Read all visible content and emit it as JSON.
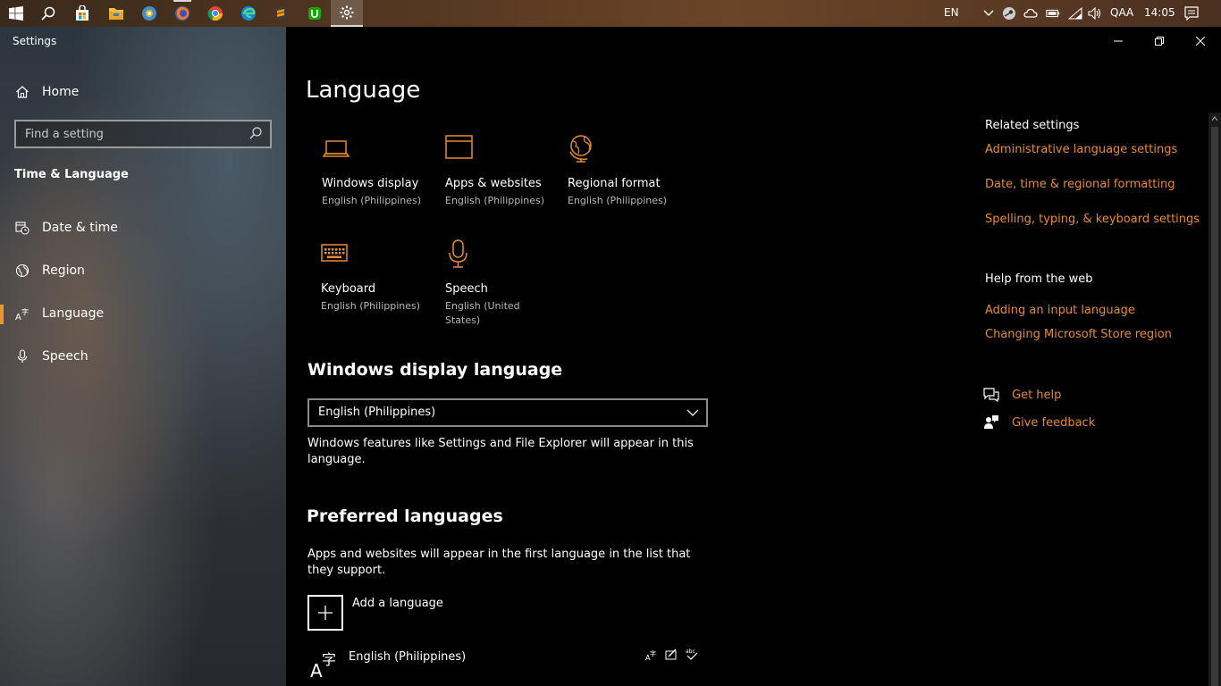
{
  "taskbar": {
    "lang_indicator": "EN",
    "user": "QAA",
    "clock": "14:05",
    "apps": [
      "start-icon",
      "search-icon",
      "store-icon",
      "file-explorer-icon",
      "browser-icon",
      "firefox-icon",
      "chrome-icon",
      "edge-icon",
      "sublime-icon",
      "upwork-icon",
      "settings-icon"
    ]
  },
  "window": {
    "app_title": "Settings"
  },
  "sidebar": {
    "home_label": "Home",
    "search_placeholder": "Find a setting",
    "section": "Time & Language",
    "items": [
      {
        "label": "Date & time",
        "icon": "calendar-clock-icon"
      },
      {
        "label": "Region",
        "icon": "globe-icon"
      },
      {
        "label": "Language",
        "icon": "language-icon",
        "selected": true
      },
      {
        "label": "Speech",
        "icon": "microphone-icon"
      }
    ]
  },
  "main": {
    "title": "Language",
    "tiles": [
      {
        "name": "Windows display",
        "sub": "English (Philippines)",
        "icon": "laptop-icon"
      },
      {
        "name": "Apps & websites",
        "sub": "English (Philippines)",
        "icon": "window-icon"
      },
      {
        "name": "Regional format",
        "sub": "English (Philippines)",
        "icon": "globe-icon"
      },
      {
        "name": "Keyboard",
        "sub": "English (Philippines)",
        "icon": "keyboard-icon"
      },
      {
        "name": "Speech",
        "sub": "English (United States)",
        "icon": "microphone-icon"
      }
    ],
    "display_language": {
      "heading": "Windows display language",
      "selected": "English (Philippines)",
      "description": "Windows features like Settings and File Explorer will appear in this language."
    },
    "preferred": {
      "heading": "Preferred languages",
      "description": "Apps and websites will appear in the first language in the list that they support.",
      "add_label": "Add a language",
      "languages": [
        {
          "name": "English (Philippines)"
        }
      ]
    }
  },
  "related": {
    "heading": "Related settings",
    "links": [
      "Administrative language settings",
      "Date, time & regional formatting",
      "Spelling, typing, & keyboard settings"
    ],
    "help_heading": "Help from the web",
    "help_links": [
      "Adding an input language",
      "Changing Microsoft Store region"
    ],
    "get_help": "Get help",
    "give_feedback": "Give feedback"
  },
  "colors": {
    "accent": "#e98a2d",
    "selected_bar": "#f0942b",
    "background": "#000000"
  }
}
